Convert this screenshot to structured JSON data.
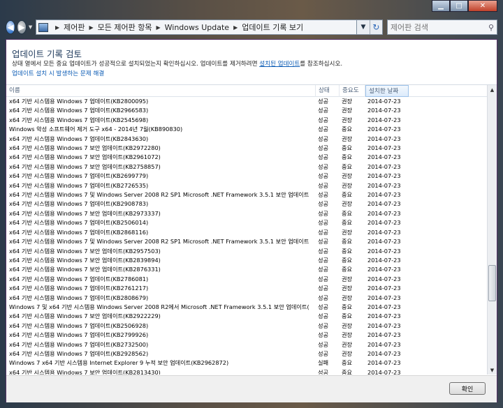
{
  "window": {
    "controls": {
      "minimize": "▁",
      "maximize": "□",
      "close": "✕"
    }
  },
  "address": {
    "breadcrumbs": [
      "제어판",
      "모든 제어판 항목",
      "Windows Update",
      "업데이트 기록 보기"
    ],
    "search_placeholder": "제어판 검색"
  },
  "page": {
    "title": "업데이트 기록 검토",
    "description_prefix": "상태 열에서 모든 중요 업데이트가 성공적으로 설치되었는지 확인하십시오. 업데이트를 제거하려면 ",
    "description_link": "설치된 업데이트",
    "description_suffix": "를 참조하십시오.",
    "trouble_link": "업데이트 설치 시 발생하는 문제 해결"
  },
  "table": {
    "columns": {
      "name": "이름",
      "status": "상태",
      "importance": "중요도",
      "date": "설치한 날짜"
    },
    "rows": [
      {
        "name": "x64 기반 시스템용 Windows 7 업데이트(KB2800095)",
        "status": "성공",
        "importance": "권장",
        "date": "2014-07-23"
      },
      {
        "name": "x64 기반 시스템용 Windows 7 업데이트(KB2966583)",
        "status": "성공",
        "importance": "권장",
        "date": "2014-07-23"
      },
      {
        "name": "x64 기반 시스템용 Windows 7 업데이트(KB2545698)",
        "status": "성공",
        "importance": "권장",
        "date": "2014-07-23"
      },
      {
        "name": "Windows 악성 소프트웨어 제거 도구 x64 - 2014년 7월(KB890830)",
        "status": "성공",
        "importance": "중요",
        "date": "2014-07-23"
      },
      {
        "name": "x64 기반 시스템용 Windows 7 업데이트(KB2843630)",
        "status": "성공",
        "importance": "권장",
        "date": "2014-07-23"
      },
      {
        "name": "x64 기반 시스템용 Windows 7 보안 업데이트(KB2972280)",
        "status": "성공",
        "importance": "중요",
        "date": "2014-07-23"
      },
      {
        "name": "x64 기반 시스템용 Windows 7 보안 업데이트(KB2961072)",
        "status": "성공",
        "importance": "중요",
        "date": "2014-07-23"
      },
      {
        "name": "x64 기반 시스템용 Windows 7 보안 업데이트(KB2758857)",
        "status": "성공",
        "importance": "중요",
        "date": "2014-07-23"
      },
      {
        "name": "x64 기반 시스템용 Windows 7 업데이트(KB2699779)",
        "status": "성공",
        "importance": "권장",
        "date": "2014-07-23"
      },
      {
        "name": "x64 기반 시스템용 Windows 7 업데이트(KB2726535)",
        "status": "성공",
        "importance": "권장",
        "date": "2014-07-23"
      },
      {
        "name": "x64 기반 시스템용 Windows 7 및 Windows Server 2008 R2 SP1 Microsoft .NET Framework 3.5.1 보안 업데이트(KB...",
        "status": "성공",
        "importance": "중요",
        "date": "2014-07-23"
      },
      {
        "name": "x64 기반 시스템용 Windows 7 업데이트(KB2908783)",
        "status": "성공",
        "importance": "권장",
        "date": "2014-07-23"
      },
      {
        "name": "x64 기반 시스템용 Windows 7 보안 업데이트(KB2973337)",
        "status": "성공",
        "importance": "중요",
        "date": "2014-07-23"
      },
      {
        "name": "x64 기반 시스템용 Windows 7 업데이트(KB2506014)",
        "status": "성공",
        "importance": "중요",
        "date": "2014-07-23"
      },
      {
        "name": "x64 기반 시스템용 Windows 7 업데이트(KB2868116)",
        "status": "성공",
        "importance": "권장",
        "date": "2014-07-23"
      },
      {
        "name": "x64 기반 시스템용 Windows 7 및 Windows Server 2008 R2 SP1 Microsoft .NET Framework 3.5.1 보안 업데이트(KB...",
        "status": "성공",
        "importance": "중요",
        "date": "2014-07-23"
      },
      {
        "name": "x64 기반 시스템용 Windows 7 보안 업데이트(KB2957503)",
        "status": "성공",
        "importance": "중요",
        "date": "2014-07-23"
      },
      {
        "name": "x64 기반 시스템용 Windows 7 보안 업데이트(KB2839894)",
        "status": "성공",
        "importance": "중요",
        "date": "2014-07-23"
      },
      {
        "name": "x64 기반 시스템용 Windows 7 보안 업데이트(KB2876331)",
        "status": "성공",
        "importance": "중요",
        "date": "2014-07-23"
      },
      {
        "name": "x64 기반 시스템용 Windows 7 업데이트(KB2786081)",
        "status": "성공",
        "importance": "권장",
        "date": "2014-07-23"
      },
      {
        "name": "x64 기반 시스템용 Windows 7 업데이트(KB2761217)",
        "status": "성공",
        "importance": "권장",
        "date": "2014-07-23"
      },
      {
        "name": "x64 기반 시스템용 Windows 7 업데이트(KB2808679)",
        "status": "성공",
        "importance": "권장",
        "date": "2014-07-23"
      },
      {
        "name": "Windows 7 및 x64 기반 시스템용 Windows Server 2008 R2에서 Microsoft .NET Framework 3.5.1 보안 업데이트(KB...",
        "status": "성공",
        "importance": "중요",
        "date": "2014-07-23"
      },
      {
        "name": "x64 기반 시스템용 Windows 7 보안 업데이트(KB2922229)",
        "status": "성공",
        "importance": "중요",
        "date": "2014-07-23"
      },
      {
        "name": "x64 기반 시스템용 Windows 7 업데이트(KB2506928)",
        "status": "성공",
        "importance": "권장",
        "date": "2014-07-23"
      },
      {
        "name": "x64 기반 시스템용 Windows 7 업데이트(KB2799926)",
        "status": "성공",
        "importance": "권장",
        "date": "2014-07-23"
      },
      {
        "name": "x64 기반 시스템용 Windows 7 업데이트(KB2732500)",
        "status": "성공",
        "importance": "권장",
        "date": "2014-07-23"
      },
      {
        "name": "x64 기반 시스템용 Windows 7 업데이트(KB2928562)",
        "status": "성공",
        "importance": "권장",
        "date": "2014-07-23"
      },
      {
        "name": "Windows 7 x64 기반 시스템용 Internet Explorer 9 누적 보안 업데이트(KB2962872)",
        "status": "실패",
        "importance": "중요",
        "date": "2014-07-23"
      },
      {
        "name": "x64 기반 시스템용 Windows 7 보안 업데이트(KB2813430)",
        "status": "성공",
        "importance": "중요",
        "date": "2014-07-23"
      }
    ]
  },
  "footer": {
    "ok_label": "확인"
  },
  "icons": {
    "back": "back-arrow-icon",
    "forward": "forward-arrow-icon",
    "control_panel": "control-panel-icon",
    "refresh": "refresh-icon",
    "search": "search-icon"
  }
}
